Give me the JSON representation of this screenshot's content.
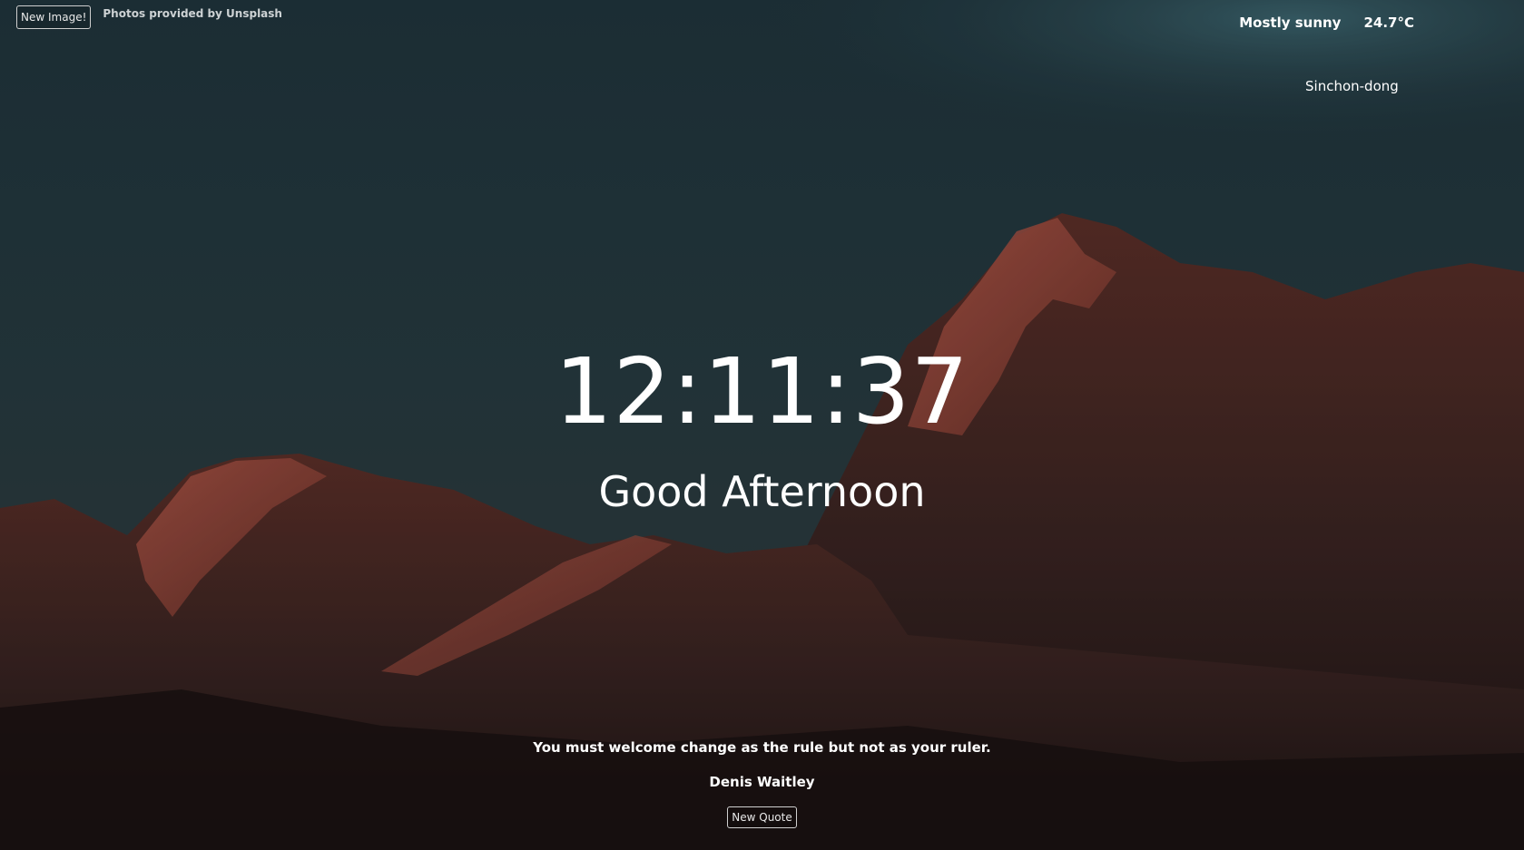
{
  "controls": {
    "new_image_label": "New Image!",
    "credit_text": "Photos provided by Unsplash"
  },
  "weather": {
    "condition": "Mostly sunny",
    "temperature": "24.7°C",
    "location": "Sinchon-dong"
  },
  "clock": {
    "time": "12:11:37",
    "greeting": "Good Afternoon"
  },
  "quote": {
    "text": "You must welcome change as the rule but not as your ruler.",
    "author": "Denis Waitley",
    "new_quote_label": "New Quote"
  },
  "colors": {
    "sky": "#22363d",
    "rock_lit": "#9a4a3a",
    "rock_shadow": "#2a1a1a",
    "text": "#ffffff"
  }
}
